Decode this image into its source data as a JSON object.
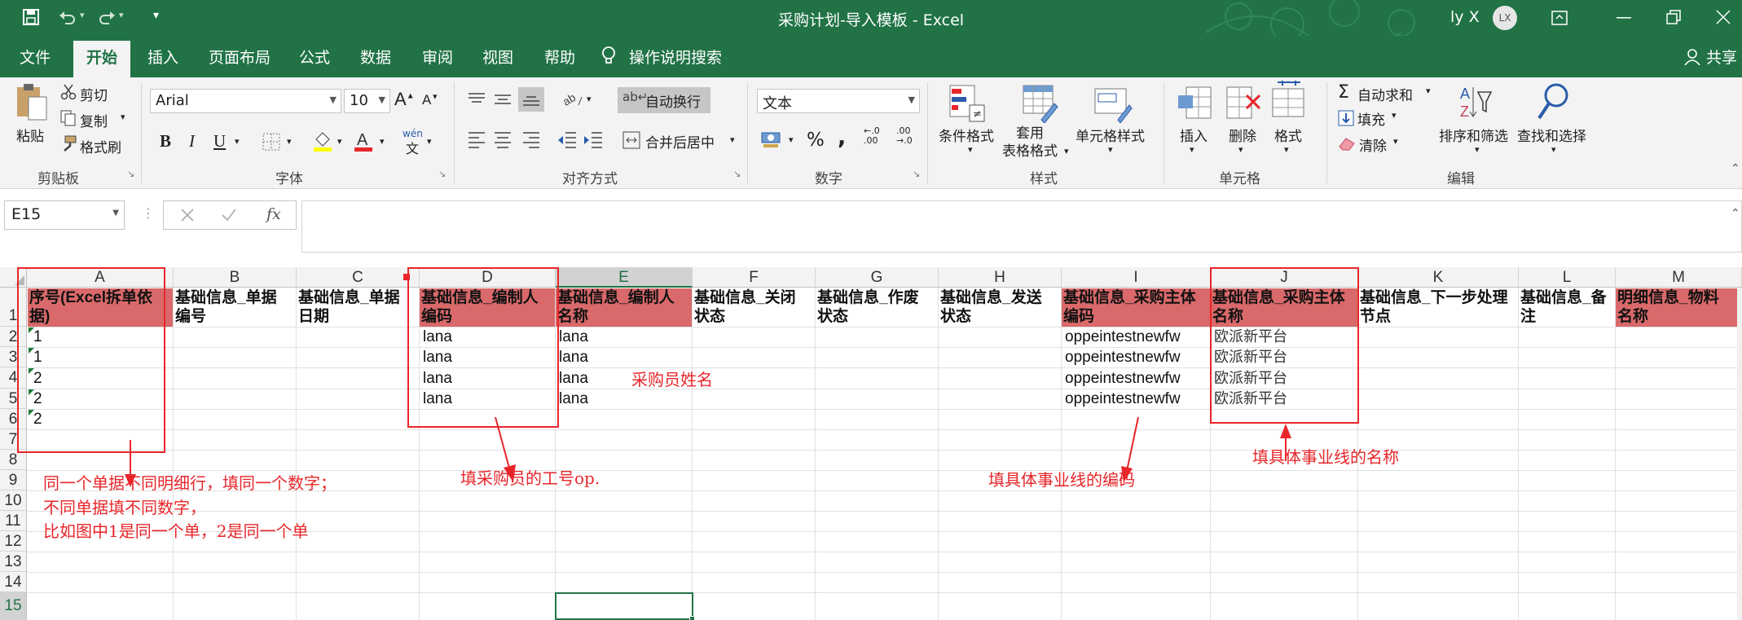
{
  "window": {
    "title": "采购计划-导入模板  -  Excel",
    "user_name": "ly X",
    "avatar_initials": "LX",
    "share_label": "共享"
  },
  "tabs": [
    "文件",
    "开始",
    "插入",
    "页面布局",
    "公式",
    "数据",
    "审阅",
    "视图",
    "帮助"
  ],
  "active_tab": "开始",
  "tell_me": "操作说明搜索",
  "ribbon": {
    "clipboard": {
      "paste": "粘贴",
      "cut": "剪切",
      "copy": "复制",
      "format_painter": "格式刷",
      "label": "剪贴板"
    },
    "font": {
      "name": "Arial",
      "size": "10",
      "label": "字体",
      "bold": "B",
      "italic": "I",
      "underline": "U",
      "phonetic": "wén"
    },
    "alignment": {
      "wrap_text": "自动换行",
      "merge_center": "合并后居中",
      "label": "对齐方式"
    },
    "number": {
      "format": "文本",
      "percent": "%",
      "comma": ",",
      "label": "数字"
    },
    "styles": {
      "conditional": "条件格式",
      "table_format": "套用\n表格格式",
      "cell_styles": "单元格样式",
      "label": "样式"
    },
    "cells": {
      "insert": "插入",
      "delete": "删除",
      "format": "格式",
      "label": "单元格"
    },
    "editing": {
      "autosum": "自动求和",
      "fill": "填充",
      "clear": "清除",
      "sort_filter": "排序和筛选",
      "find_select": "查找和选择",
      "label": "编辑"
    }
  },
  "formula_bar": {
    "name_box": "E15",
    "fx": "fx",
    "value": ""
  },
  "sheet": {
    "columns": [
      "A",
      "B",
      "C",
      "D",
      "E",
      "F",
      "G",
      "H",
      "I",
      "J",
      "K",
      "L",
      "M"
    ],
    "selected_column": "E",
    "rows": [
      "1",
      "2",
      "3",
      "4",
      "5",
      "6",
      "7",
      "8",
      "9",
      "10",
      "11",
      "12",
      "13",
      "14",
      "15"
    ],
    "selected_row": "15",
    "headers": [
      "序号(Excel拆单依\n据)",
      "基础信息_单据\n编号",
      "基础信息_单据\n日期",
      "基础信息_编制人\n编码",
      "基础信息_编制人\n名称",
      "基础信息_关闭\n状态",
      "基础信息_作废\n状态",
      "基础信息_发送\n状态",
      "基础信息_采购主体\n编码",
      "基础信息_采购主体\n名称",
      "基础信息_下一步处理\n节点",
      "基础信息_备\n注",
      "明细信息_物料\n名称"
    ],
    "data_rows": [
      {
        "A": "1",
        "D": "lana",
        "E": "lana",
        "I": "oppeintestnewfw",
        "J": "欧派新平台"
      },
      {
        "A": "1",
        "D": "lana",
        "E": "lana",
        "I": "oppeintestnewfw",
        "J": "欧派新平台"
      },
      {
        "A": "2",
        "D": "lana",
        "E": "lana",
        "I": "oppeintestnewfw",
        "J": "欧派新平台"
      },
      {
        "A": "2",
        "D": "lana",
        "E": "lana",
        "I": "oppeintestnewfw",
        "J": "欧派新平台"
      },
      {
        "A": "2",
        "D": "",
        "E": "",
        "I": "",
        "J": ""
      }
    ]
  },
  "annotations": {
    "buyer_name": "采购员姓名",
    "buyer_code": "填采购员的工号op.",
    "line_code": "填具体事业线的编码",
    "line_name": "填具体事业线的名称",
    "split_rule_1": "同一个单据不同明细行，填同一个数字；",
    "split_rule_2": "不同单据填不同数字，",
    "split_rule_3": "比如图中1是同一个单，2是同一个单"
  },
  "colors": {
    "accent": "#217346",
    "header_fill": "#d9696a",
    "annotation": "#e8262a"
  }
}
